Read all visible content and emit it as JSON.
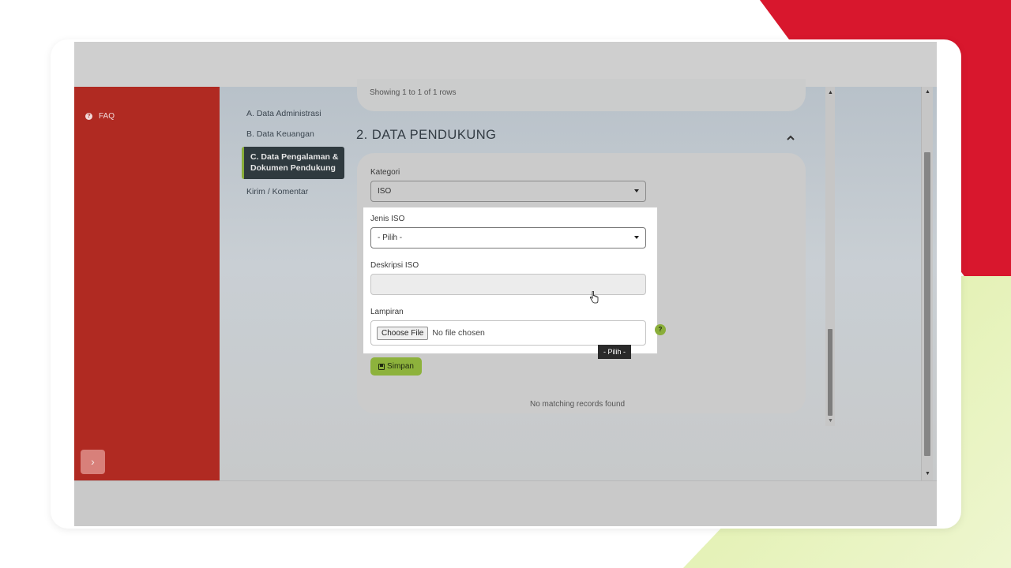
{
  "sidebar": {
    "faq_label": "FAQ",
    "toggle_label": "›"
  },
  "steps": [
    {
      "label": "A. Data Administrasi",
      "active": false
    },
    {
      "label": "B. Data Keuangan",
      "active": false
    },
    {
      "label": "C. Data Pengalaman & Dokumen Pendukung",
      "active": true
    },
    {
      "label": "Kirim / Komentar",
      "active": false
    }
  ],
  "table_top": {
    "rows_info": "Showing 1 to 1 of 1 rows"
  },
  "section": {
    "title": "2. DATA PENDUKUNG",
    "collapse_icon": "chevron-up-icon"
  },
  "form": {
    "kategori_label": "Kategori",
    "kategori_value": "ISO",
    "jenis_iso_label": "Jenis ISO",
    "jenis_iso_value": "- Pilih -",
    "deskripsi_label": "Deskripsi ISO",
    "deskripsi_value": "",
    "lampiran_label": "Lampiran",
    "choose_file_label": "Choose File",
    "no_file_text": "No file chosen",
    "help_icon": "?",
    "save_label": "Simpan"
  },
  "tooltip": "- Pilih -",
  "table_bottom": {
    "no_records": "No matching records found"
  },
  "colors": {
    "sidebar_red": "#b02a22",
    "accent_green": "#8db23c",
    "brand_red": "#d8172d",
    "brand_green": "#c5e24a"
  }
}
